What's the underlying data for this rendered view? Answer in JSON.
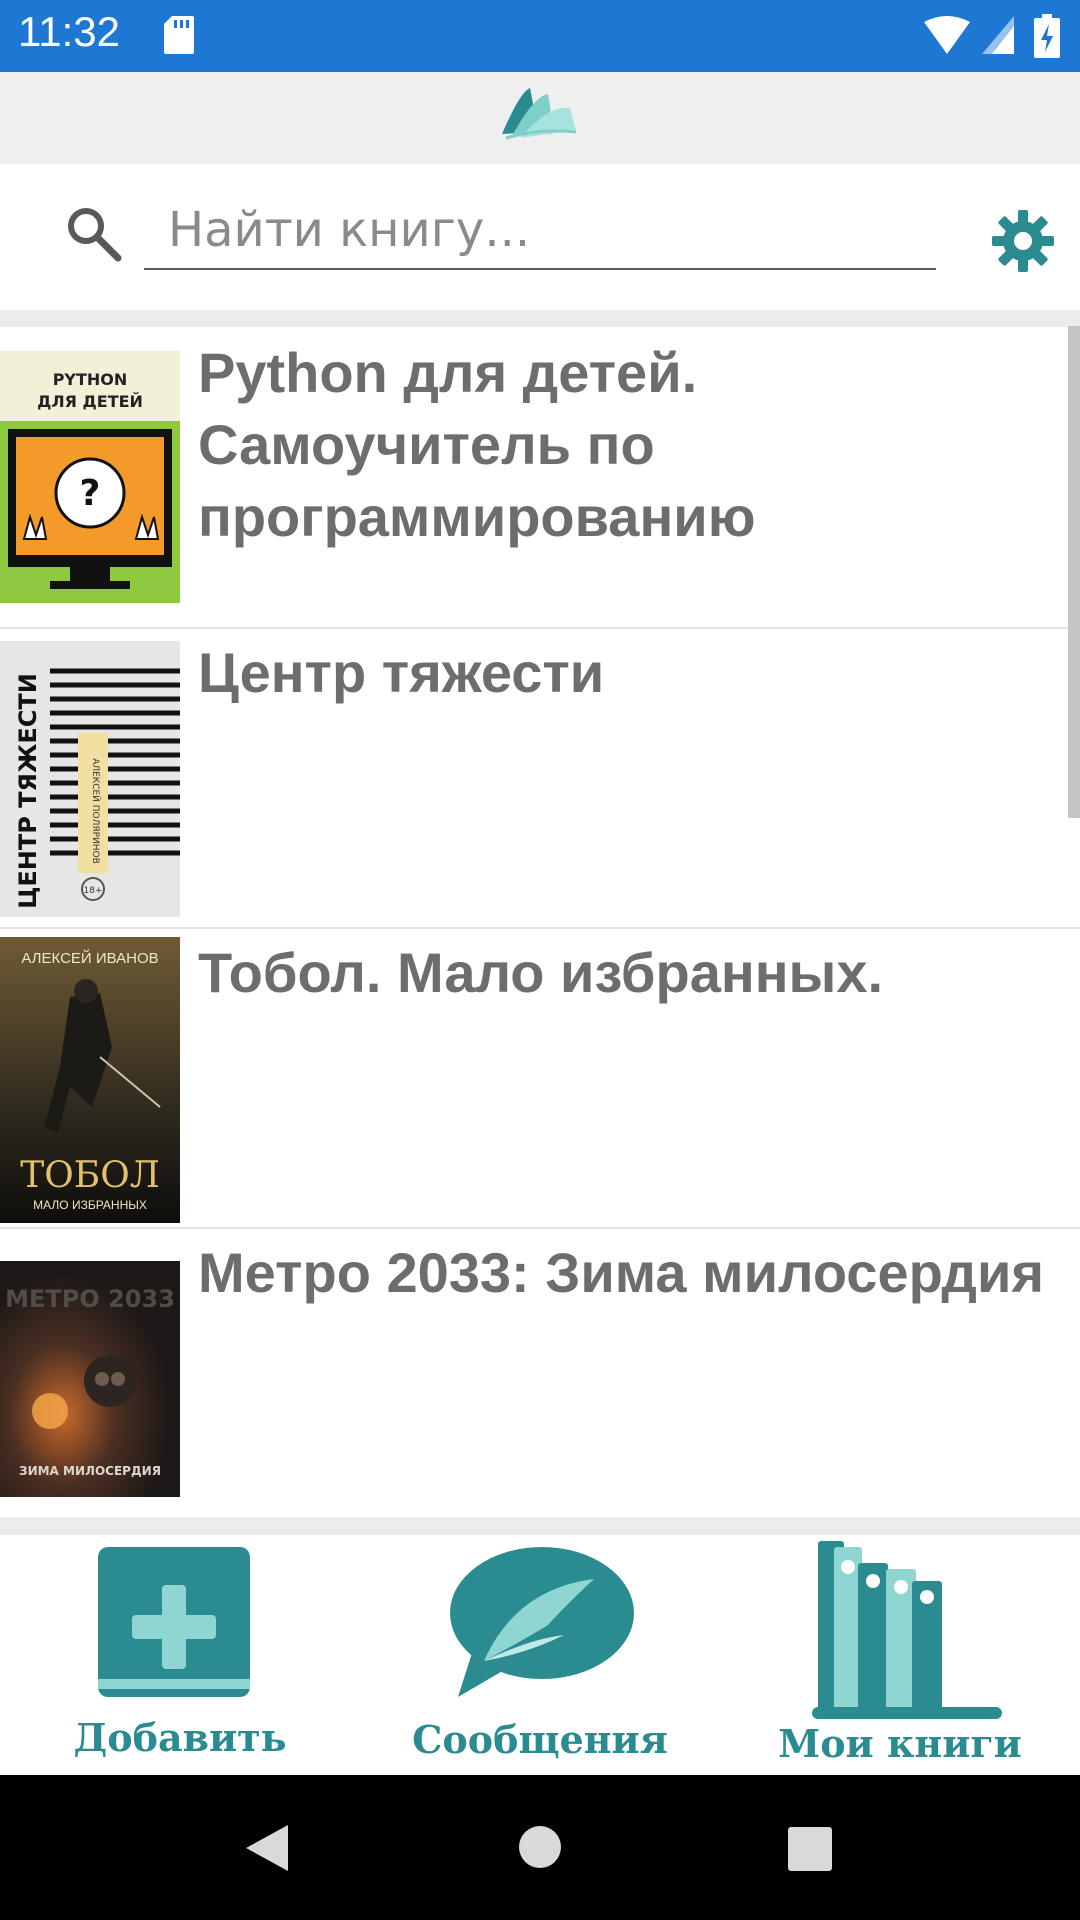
{
  "status_bar": {
    "time": "11:32",
    "icons": [
      "sd-card-icon",
      "wifi-icon",
      "signal-icon",
      "battery-icon"
    ],
    "color": "#1e77d2"
  },
  "app_bar": {
    "logo_icon": "book-logo-icon",
    "background": "#efefef"
  },
  "search": {
    "placeholder": "Найти книгу...",
    "value": "",
    "search_icon": "search-icon",
    "settings_icon": "gear-icon"
  },
  "books": [
    {
      "title": "Python для детей. Самоучитель по программированию",
      "cover_icon": "python-book-cover"
    },
    {
      "title": "Центр тяжести",
      "cover_icon": "center-of-gravity-cover"
    },
    {
      "title": "Тобол. Мало избранных.",
      "cover_icon": "tobol-cover"
    },
    {
      "title": "Метро 2033: Зима милосердия",
      "cover_icon": "metro-2033-cover"
    }
  ],
  "covers": {
    "python": {
      "title": "PYTHON",
      "subtitle": "ДЛЯ ДЕТЕЙ"
    },
    "center": {
      "title": "ЦЕНТР ТЯЖЕСТИ",
      "author": "АЛЕКСЕЙ ПОЛЯРИНОВ",
      "age": "18+"
    },
    "tobol": {
      "author": "АЛЕКСЕЙ ИВАНОВ",
      "title": "ТОБОЛ",
      "subtitle": "МАЛО ИЗБРАННЫХ"
    },
    "metro": {
      "title": "МЕТРО 2033",
      "subtitle": "ЗИМА МИЛОСЕРДИЯ"
    }
  },
  "bottom_nav": [
    {
      "label": "Добавить",
      "icon": "add-book-icon"
    },
    {
      "label": "Сообщения",
      "icon": "messages-icon"
    },
    {
      "label": "Мои книги",
      "icon": "my-books-icon"
    }
  ],
  "colors": {
    "accent": "#2a8c91",
    "accent_light": "#8fd6d2",
    "title_text": "#6d6d6d"
  },
  "system_nav": [
    "back-icon",
    "home-icon",
    "recents-icon"
  ]
}
